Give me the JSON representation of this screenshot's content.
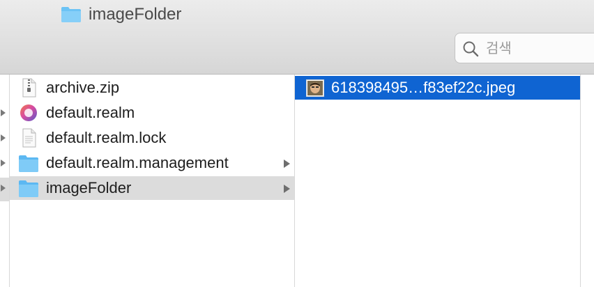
{
  "window": {
    "title": "imageFolder",
    "title_icon": "folder-icon"
  },
  "search": {
    "placeholder": "검색",
    "value": ""
  },
  "columns": [
    {
      "items": [
        {
          "label": "archive.zip",
          "icon": "zip-file-icon",
          "has_children": false,
          "selected": false
        },
        {
          "label": "default.realm",
          "icon": "realm-file-icon",
          "has_children": false,
          "selected": false
        },
        {
          "label": "default.realm.lock",
          "icon": "text-file-icon",
          "has_children": false,
          "selected": false
        },
        {
          "label": "default.realm.management",
          "icon": "folder-icon",
          "has_children": true,
          "selected": false
        },
        {
          "label": "imageFolder",
          "icon": "folder-icon",
          "has_children": true,
          "selected": true
        }
      ]
    },
    {
      "items": [
        {
          "label": "618398495…f83ef22c.jpeg",
          "icon": "image-thumbnail-icon",
          "has_children": false,
          "selected": true
        }
      ]
    }
  ],
  "colors": {
    "selection_active": "#0f64d2",
    "selection_inactive": "#dcdcdc",
    "folder_blue": "#5cb8f2"
  }
}
